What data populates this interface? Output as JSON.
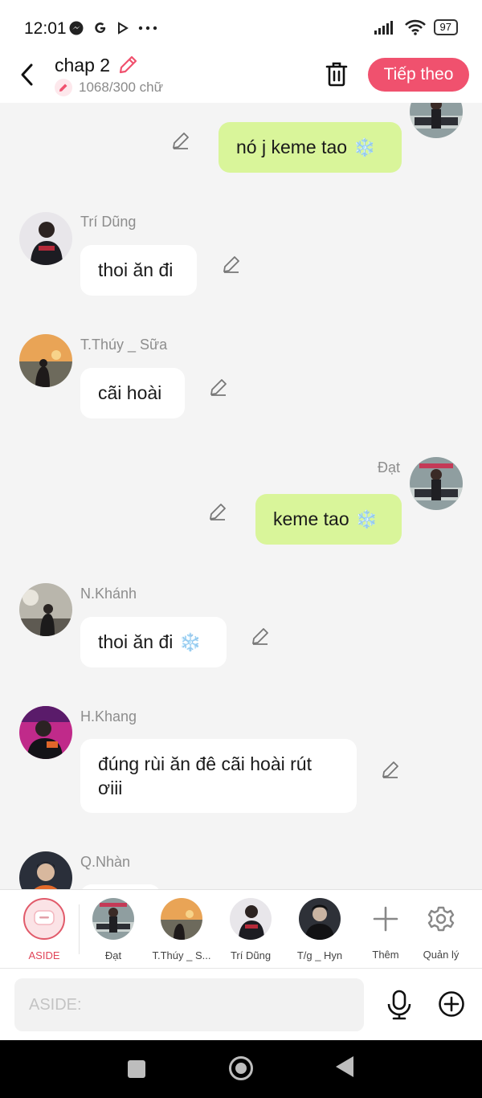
{
  "status": {
    "time": "12:01",
    "battery": "97",
    "icons": [
      "messenger-icon",
      "google-icon",
      "play-icon",
      "more-dots-icon",
      "signal-icon",
      "wifi-icon",
      "battery-icon"
    ]
  },
  "header": {
    "title": "chap 2",
    "word_count": "1068/300 chữ",
    "next_label": "Tiếp theo"
  },
  "messages": [
    {
      "side": "right",
      "name": "",
      "text": "nó j keme tao",
      "emoji": "❄️"
    },
    {
      "side": "left",
      "name": "Trí Dũng",
      "text": "thoi ăn đi",
      "emoji": ""
    },
    {
      "side": "left",
      "name": "T.Thúy _ Sữa",
      "text": "cãi hoài",
      "emoji": ""
    },
    {
      "side": "right",
      "name": "Đạt",
      "text": "keme tao",
      "emoji": "❄️"
    },
    {
      "side": "left",
      "name": "N.Khánh",
      "text": "thoi ăn đi",
      "emoji": "❄️"
    },
    {
      "side": "left",
      "name": "H.Khang",
      "text": "đúng rùi ăn đê cãi hoài rút ơiii",
      "emoji": ""
    },
    {
      "side": "left",
      "name": "Q.Nhàn",
      "text": "",
      "emoji": ""
    }
  ],
  "characters": [
    {
      "label": "ASIDE"
    },
    {
      "label": "Đạt"
    },
    {
      "label": "T.Thúy _ S..."
    },
    {
      "label": "Trí Dũng"
    },
    {
      "label": "T/g _ Hyn"
    },
    {
      "label": "Thêm"
    },
    {
      "label": "Quản lý"
    }
  ],
  "input": {
    "placeholder": "ASIDE:"
  },
  "colors": {
    "accent": "#f0516e",
    "right_bubble": "#d9f59a",
    "left_bubble": "#ffffff",
    "background": "#f4f4f4"
  }
}
